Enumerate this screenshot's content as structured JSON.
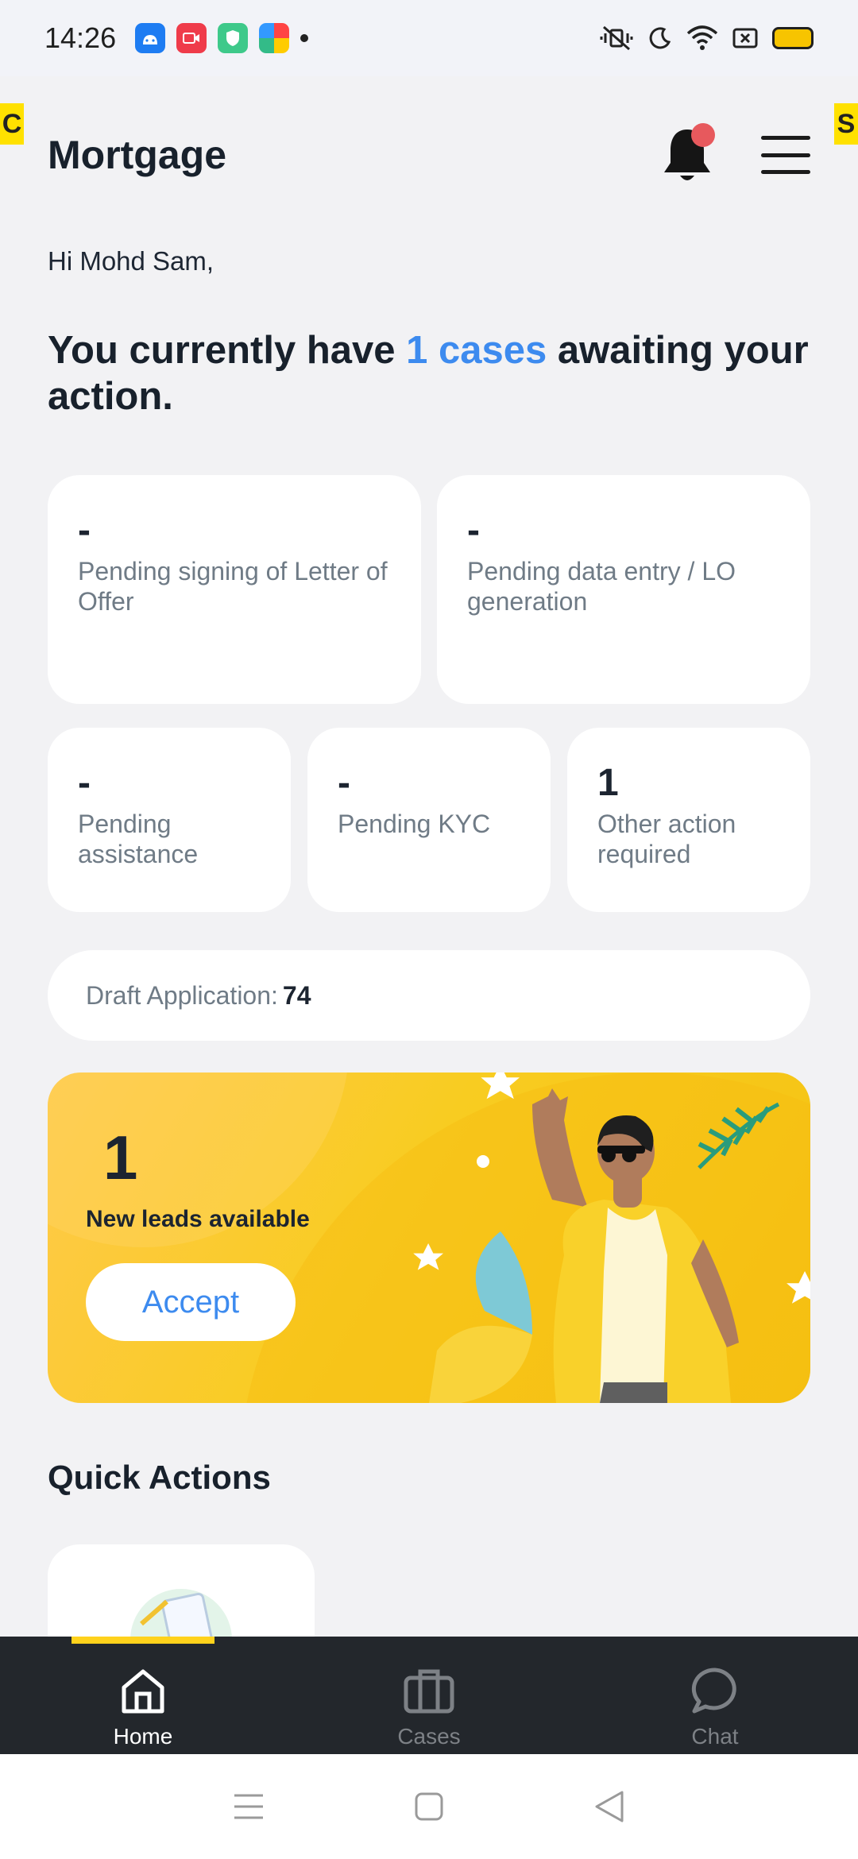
{
  "status_bar": {
    "time": "14:26",
    "app_icons": [
      "android-icon",
      "video-icon",
      "shield-icon",
      "browser-icon"
    ],
    "indicators": [
      "mute-vibrate-icon",
      "moon-icon",
      "wifi-icon",
      "sim-icon",
      "battery-icon"
    ]
  },
  "side_marks": {
    "left": "C",
    "right": "S"
  },
  "header": {
    "title": "Mortgage"
  },
  "greeting": "Hi Mohd Sam,",
  "headline": {
    "prefix": "You currently have",
    "highlight": "1 cases",
    "suffix": "awaiting your action."
  },
  "stat_cards": [
    {
      "value": "-",
      "label": "Pending signing of Letter of Offer"
    },
    {
      "value": "-",
      "label": "Pending data entry / LO generation"
    },
    {
      "value": "-",
      "label": "Pending assistance"
    },
    {
      "value": "-",
      "label": "Pending KYC"
    },
    {
      "value": "1",
      "label": "Other action required"
    }
  ],
  "draft": {
    "label": "Draft Application:",
    "value": "74"
  },
  "leads": {
    "count": "1",
    "label": "New leads available",
    "accept_label": "Accept"
  },
  "quick_actions": {
    "title": "Quick Actions"
  },
  "bottom_nav": [
    {
      "label": "Home",
      "icon": "home-icon",
      "active": true
    },
    {
      "label": "Cases",
      "icon": "briefcase-icon",
      "active": false
    },
    {
      "label": "Chat",
      "icon": "chat-icon",
      "active": false
    }
  ],
  "colors": {
    "accent": "#3d8bef",
    "brand_yellow": "#f8cc21",
    "nav_bg": "#23272c",
    "badge": "#e7595d"
  }
}
